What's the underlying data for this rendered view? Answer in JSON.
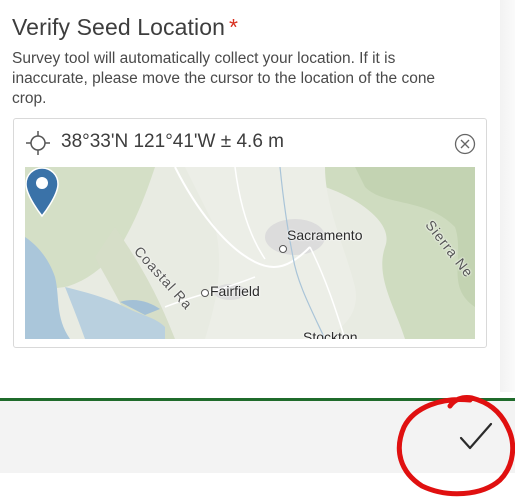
{
  "question": {
    "title": "Verify Seed Location",
    "required_marker": "*",
    "description": "Survey tool will automatically collect your location. If it is inaccurate, please move the cursor to the location of the cone crop."
  },
  "location": {
    "coordinates": "38°33'N 121°41'W ± 4.6 m"
  },
  "map": {
    "labels": {
      "sacramento": "Sacramento",
      "fairfield": "Fairfield",
      "stockton": "Stockton",
      "coastal": "Coastal Ra",
      "sierra": "Sierra Ne"
    }
  },
  "colors": {
    "required": "#d83020",
    "pin": "#3a72a8",
    "footer_rule": "#1f6b2b",
    "annotation_circle": "#e01010"
  },
  "icons": {
    "crosshair": "crosshair-icon",
    "clear": "clear-circle-x-icon",
    "pin": "map-pin-icon",
    "submit": "checkmark-icon"
  }
}
